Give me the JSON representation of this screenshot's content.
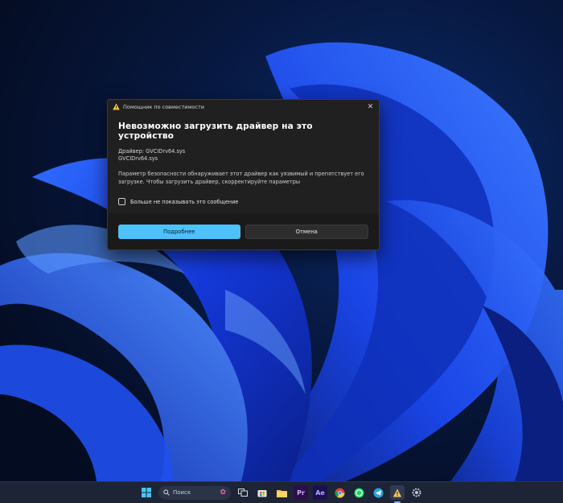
{
  "dialog": {
    "window_title": "Помощник по совместимости",
    "heading": "Невозможно загрузить драйвер на это устройство",
    "driver_line": "Драйвер: GVCIDrv64.sys",
    "file_line": "GVCIDrv64.sys",
    "description": "Параметр безопасности обнаруживает этот драйвер как уязвимый и препятствует его загрузке. Чтобы загрузить драйвер, скорректируйте параметры",
    "checkbox_label": "Больше не показывать это сообщение",
    "checkbox_checked": false,
    "primary_button": "Подробнее",
    "secondary_button": "Отмена",
    "accent_color": "#4cc2ff"
  },
  "taskbar": {
    "search_placeholder": "Поиск",
    "apps": [
      "windows-start-icon",
      "search-icon",
      "task-view-icon",
      "microsoft-store-icon",
      "file-explorer-icon",
      "premiere-pro-icon",
      "after-effects-icon",
      "chrome-icon",
      "whatsapp-icon",
      "telegram-icon",
      "warning-icon",
      "settings-icon"
    ]
  }
}
